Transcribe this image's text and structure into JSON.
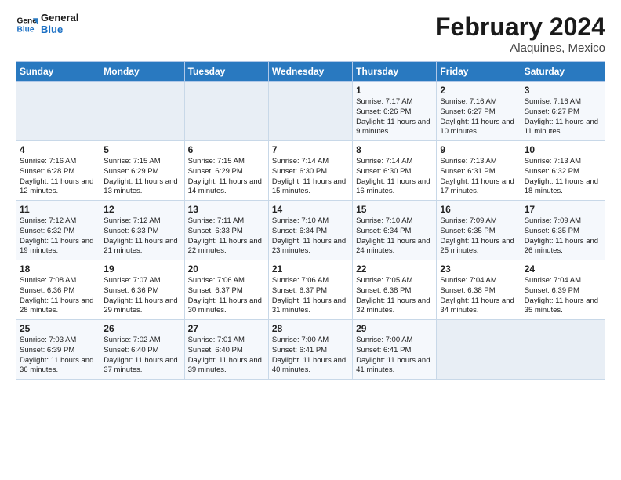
{
  "logo": {
    "line1": "General",
    "line2": "Blue"
  },
  "title": "February 2024",
  "subtitle": "Alaquines, Mexico",
  "days_of_week": [
    "Sunday",
    "Monday",
    "Tuesday",
    "Wednesday",
    "Thursday",
    "Friday",
    "Saturday"
  ],
  "weeks": [
    [
      {
        "num": "",
        "info": ""
      },
      {
        "num": "",
        "info": ""
      },
      {
        "num": "",
        "info": ""
      },
      {
        "num": "",
        "info": ""
      },
      {
        "num": "1",
        "info": "Sunrise: 7:17 AM\nSunset: 6:26 PM\nDaylight: 11 hours and 9 minutes."
      },
      {
        "num": "2",
        "info": "Sunrise: 7:16 AM\nSunset: 6:27 PM\nDaylight: 11 hours and 10 minutes."
      },
      {
        "num": "3",
        "info": "Sunrise: 7:16 AM\nSunset: 6:27 PM\nDaylight: 11 hours and 11 minutes."
      }
    ],
    [
      {
        "num": "4",
        "info": "Sunrise: 7:16 AM\nSunset: 6:28 PM\nDaylight: 11 hours and 12 minutes."
      },
      {
        "num": "5",
        "info": "Sunrise: 7:15 AM\nSunset: 6:29 PM\nDaylight: 11 hours and 13 minutes."
      },
      {
        "num": "6",
        "info": "Sunrise: 7:15 AM\nSunset: 6:29 PM\nDaylight: 11 hours and 14 minutes."
      },
      {
        "num": "7",
        "info": "Sunrise: 7:14 AM\nSunset: 6:30 PM\nDaylight: 11 hours and 15 minutes."
      },
      {
        "num": "8",
        "info": "Sunrise: 7:14 AM\nSunset: 6:30 PM\nDaylight: 11 hours and 16 minutes."
      },
      {
        "num": "9",
        "info": "Sunrise: 7:13 AM\nSunset: 6:31 PM\nDaylight: 11 hours and 17 minutes."
      },
      {
        "num": "10",
        "info": "Sunrise: 7:13 AM\nSunset: 6:32 PM\nDaylight: 11 hours and 18 minutes."
      }
    ],
    [
      {
        "num": "11",
        "info": "Sunrise: 7:12 AM\nSunset: 6:32 PM\nDaylight: 11 hours and 19 minutes."
      },
      {
        "num": "12",
        "info": "Sunrise: 7:12 AM\nSunset: 6:33 PM\nDaylight: 11 hours and 21 minutes."
      },
      {
        "num": "13",
        "info": "Sunrise: 7:11 AM\nSunset: 6:33 PM\nDaylight: 11 hours and 22 minutes."
      },
      {
        "num": "14",
        "info": "Sunrise: 7:10 AM\nSunset: 6:34 PM\nDaylight: 11 hours and 23 minutes."
      },
      {
        "num": "15",
        "info": "Sunrise: 7:10 AM\nSunset: 6:34 PM\nDaylight: 11 hours and 24 minutes."
      },
      {
        "num": "16",
        "info": "Sunrise: 7:09 AM\nSunset: 6:35 PM\nDaylight: 11 hours and 25 minutes."
      },
      {
        "num": "17",
        "info": "Sunrise: 7:09 AM\nSunset: 6:35 PM\nDaylight: 11 hours and 26 minutes."
      }
    ],
    [
      {
        "num": "18",
        "info": "Sunrise: 7:08 AM\nSunset: 6:36 PM\nDaylight: 11 hours and 28 minutes."
      },
      {
        "num": "19",
        "info": "Sunrise: 7:07 AM\nSunset: 6:36 PM\nDaylight: 11 hours and 29 minutes."
      },
      {
        "num": "20",
        "info": "Sunrise: 7:06 AM\nSunset: 6:37 PM\nDaylight: 11 hours and 30 minutes."
      },
      {
        "num": "21",
        "info": "Sunrise: 7:06 AM\nSunset: 6:37 PM\nDaylight: 11 hours and 31 minutes."
      },
      {
        "num": "22",
        "info": "Sunrise: 7:05 AM\nSunset: 6:38 PM\nDaylight: 11 hours and 32 minutes."
      },
      {
        "num": "23",
        "info": "Sunrise: 7:04 AM\nSunset: 6:38 PM\nDaylight: 11 hours and 34 minutes."
      },
      {
        "num": "24",
        "info": "Sunrise: 7:04 AM\nSunset: 6:39 PM\nDaylight: 11 hours and 35 minutes."
      }
    ],
    [
      {
        "num": "25",
        "info": "Sunrise: 7:03 AM\nSunset: 6:39 PM\nDaylight: 11 hours and 36 minutes."
      },
      {
        "num": "26",
        "info": "Sunrise: 7:02 AM\nSunset: 6:40 PM\nDaylight: 11 hours and 37 minutes."
      },
      {
        "num": "27",
        "info": "Sunrise: 7:01 AM\nSunset: 6:40 PM\nDaylight: 11 hours and 39 minutes."
      },
      {
        "num": "28",
        "info": "Sunrise: 7:00 AM\nSunset: 6:41 PM\nDaylight: 11 hours and 40 minutes."
      },
      {
        "num": "29",
        "info": "Sunrise: 7:00 AM\nSunset: 6:41 PM\nDaylight: 11 hours and 41 minutes."
      },
      {
        "num": "",
        "info": ""
      },
      {
        "num": "",
        "info": ""
      }
    ]
  ]
}
